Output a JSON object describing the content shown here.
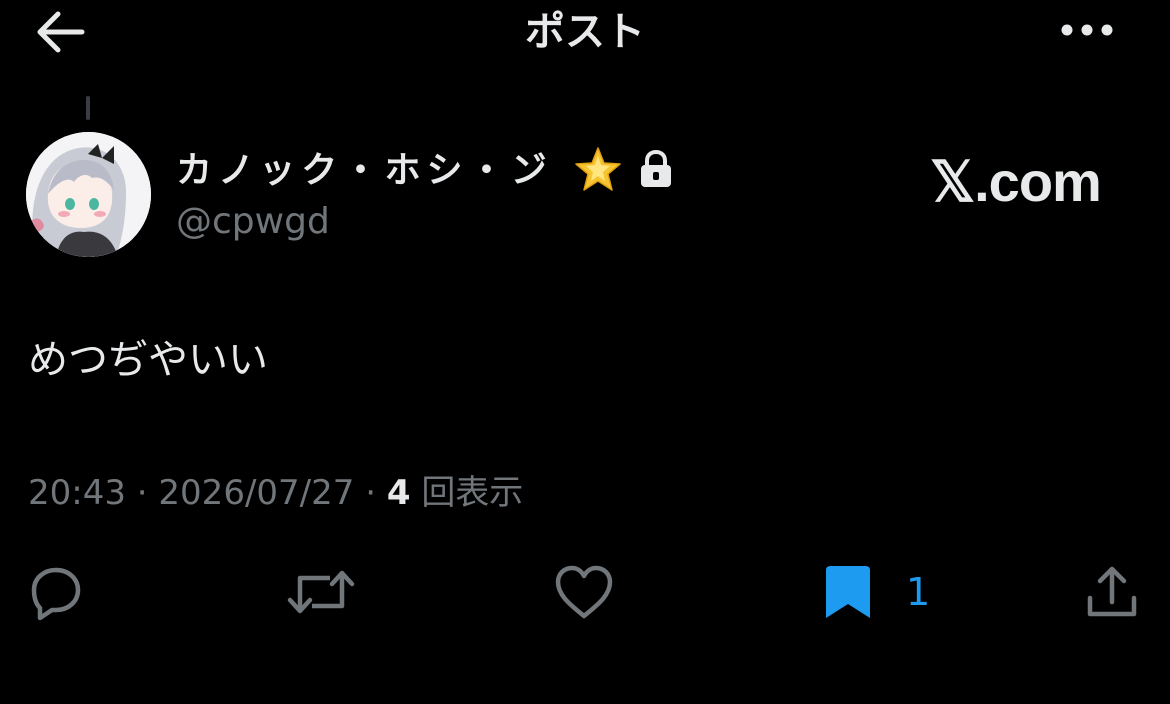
{
  "header": {
    "title": "ポスト"
  },
  "author": {
    "display_name": "カノック・ホシ・ン゙",
    "handle": "@cpwgd"
  },
  "watermark": "𝕏.com",
  "post": {
    "text": "めつぢやいい"
  },
  "meta": {
    "time": "20:43",
    "date": "2026/07/27",
    "views_count": "4",
    "views_label": "回表示",
    "separator": "·"
  },
  "actions": {
    "bookmark_count": "1"
  },
  "colors": {
    "background": "#000000",
    "text_primary": "#e7e9ea",
    "text_secondary": "#71767b",
    "accent_blue": "#1d9bf0"
  },
  "icons": [
    "back-arrow-icon",
    "more-icon",
    "sparkle-star-icon",
    "lock-icon",
    "reply-icon",
    "retweet-icon",
    "like-icon",
    "bookmark-icon",
    "share-icon"
  ]
}
